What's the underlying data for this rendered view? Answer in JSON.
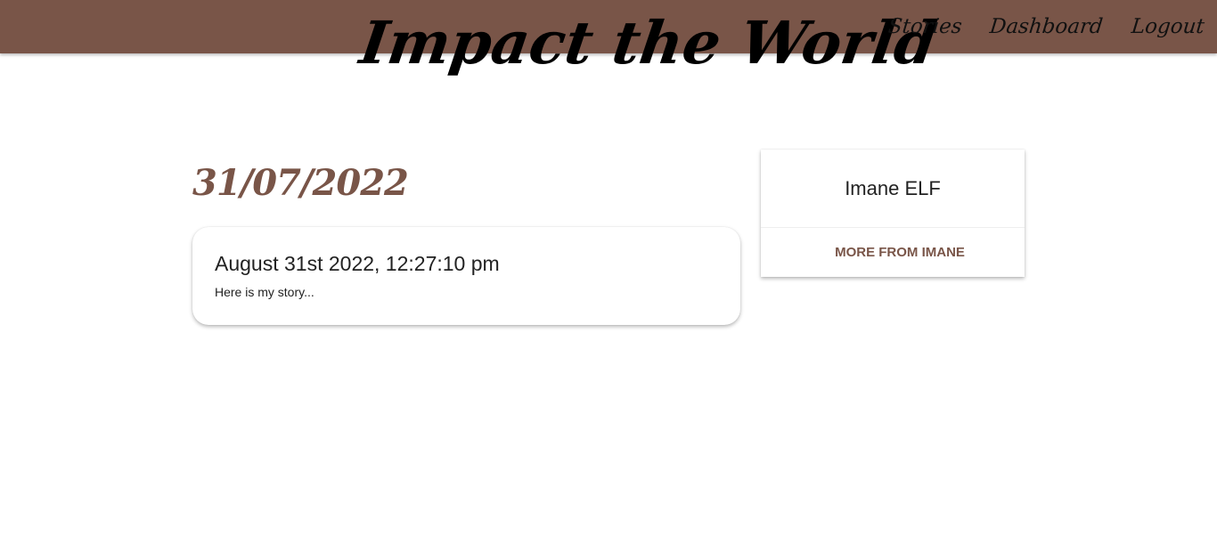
{
  "brand": {
    "title": "Impact the World"
  },
  "nav": {
    "items": [
      "Stories",
      "Dashboard",
      "Logout"
    ]
  },
  "story": {
    "date": "31/07/2022",
    "title": "August 31st 2022, 12:27:10 pm",
    "body": "Here is my story..."
  },
  "author": {
    "name": "Imane ELF",
    "more_label": "MORE FROM IMANE"
  },
  "colors": {
    "accent": "#795548",
    "background": "#ffffff"
  }
}
